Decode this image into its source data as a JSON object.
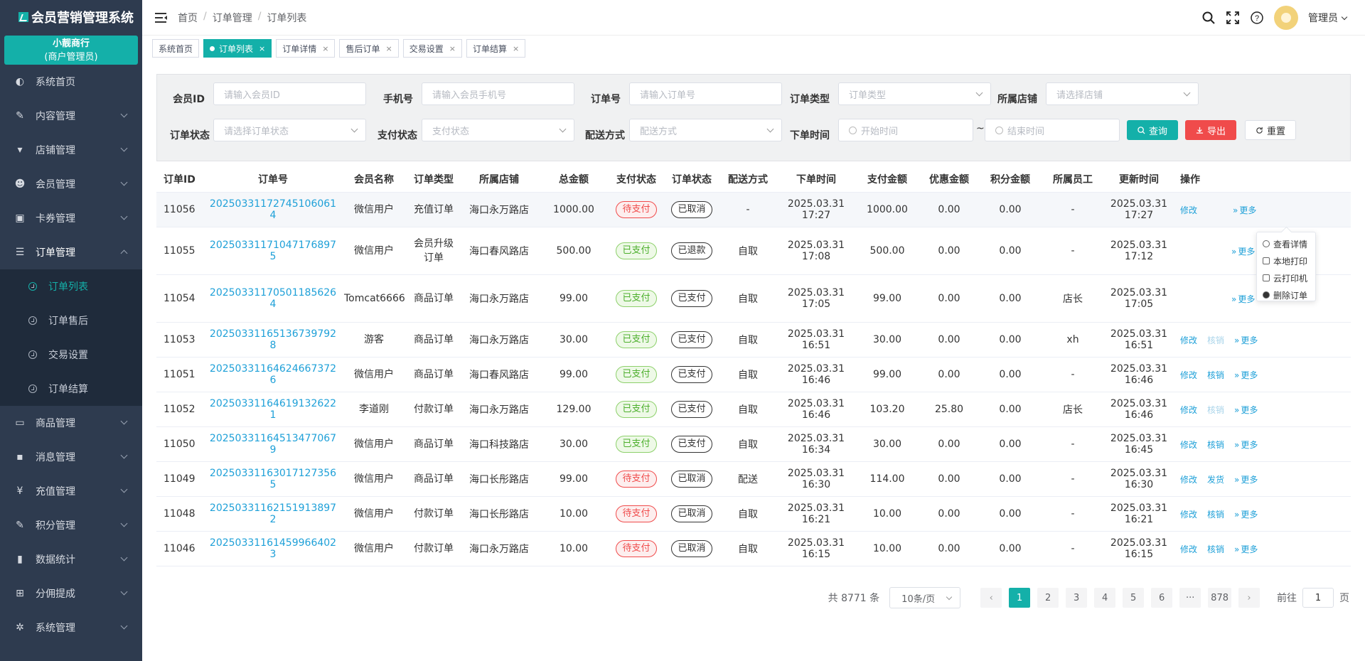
{
  "app": {
    "title": "会员营销管理系统"
  },
  "shop": {
    "name": "小靓商行",
    "role": "(商户管理员)"
  },
  "menu": [
    {
      "label": "系统首页",
      "icon": "dashboard-icon"
    },
    {
      "label": "内容管理",
      "icon": "edit-icon"
    },
    {
      "label": "店铺管理",
      "icon": "cart-icon"
    },
    {
      "label": "会员管理",
      "icon": "users-icon"
    },
    {
      "label": "卡券管理",
      "icon": "coupon-icon"
    },
    {
      "label": "订单管理",
      "icon": "list-icon"
    },
    {
      "label": "商品管理",
      "icon": "monitor-icon"
    },
    {
      "label": "消息管理",
      "icon": "message-icon"
    },
    {
      "label": "充值管理",
      "icon": "yen-icon"
    },
    {
      "label": "积分管理",
      "icon": "points-icon"
    },
    {
      "label": "数据统计",
      "icon": "bar-chart-icon"
    },
    {
      "label": "分佣提成",
      "icon": "sitemap-icon"
    },
    {
      "label": "系统管理",
      "icon": "gear-icon"
    }
  ],
  "submenu": [
    "订单列表",
    "订单售后",
    "交易设置",
    "订单结算"
  ],
  "breadcrumb": [
    "首页",
    "订单管理",
    "订单列表"
  ],
  "user": {
    "name": "管理员"
  },
  "tabs": [
    "系统首页",
    "订单列表",
    "订单详情",
    "售后订单",
    "交易设置",
    "订单结算"
  ],
  "filters": {
    "member_id": {
      "label": "会员ID",
      "placeholder": "请输入会员ID"
    },
    "phone": {
      "label": "手机号",
      "placeholder": "请输入会员手机号"
    },
    "order_no": {
      "label": "订单号",
      "placeholder": "请输入订单号"
    },
    "order_type": {
      "label": "订单类型",
      "placeholder": "订单类型"
    },
    "store": {
      "label": "所属店铺",
      "placeholder": "请选择店铺"
    },
    "order_status": {
      "label": "订单状态",
      "placeholder": "请选择订单状态"
    },
    "pay_status": {
      "label": "支付状态",
      "placeholder": "支付状态"
    },
    "delivery": {
      "label": "配送方式",
      "placeholder": "配送方式"
    },
    "order_time": {
      "label": "下单时间",
      "start": "开始时间",
      "sep": "~",
      "end": "结束时间"
    },
    "query_label": "查询",
    "export_label": "导出",
    "reset_label": "重置"
  },
  "table": {
    "headers": [
      "订单ID",
      "订单号",
      "会员名称",
      "订单类型",
      "所属店铺",
      "总金额",
      "支付状态",
      "订单状态",
      "配送方式",
      "下单时间",
      "支付金额",
      "优惠金额",
      "积分金额",
      "所属员工",
      "更新时间",
      "操作"
    ],
    "rows": [
      {
        "id": "11056",
        "no": "20250331172745106061 4",
        "member": "微信用户",
        "type": "充值订单",
        "store": "海口永万路店",
        "total": "1000.00",
        "pay": "待支付",
        "status": "已取消",
        "delivery": "-",
        "time": "2025.03.31 17:27",
        "paid": "1000.00",
        "discount": "0.00",
        "points": "0.00",
        "staff": "-",
        "updated": "2025.03.31 17:27",
        "ops": [
          "修改",
          "",
          "更多"
        ]
      },
      {
        "id": "11055",
        "no": "20250331171047176897 5",
        "member": "微信用户",
        "type": "会员升级订单",
        "store": "海口春风路店",
        "total": "500.00",
        "pay": "已支付",
        "status": "已退款",
        "delivery": "自取",
        "time": "2025.03.31 17:08",
        "paid": "500.00",
        "discount": "0.00",
        "points": "0.00",
        "staff": "-",
        "updated": "2025.03.31 17:12",
        "ops": [
          "",
          "",
          "更多"
        ]
      },
      {
        "id": "11054",
        "no": "20250331170501185626 4",
        "member": "Tomcat6666",
        "type": "商品订单",
        "store": "海口永万路店",
        "total": "99.00",
        "pay": "已支付",
        "status": "已支付",
        "delivery": "自取",
        "time": "2025.03.31 17:05",
        "paid": "99.00",
        "discount": "0.00",
        "points": "0.00",
        "staff": "店长",
        "updated": "2025.03.31 17:05",
        "ops": [
          "",
          "",
          "更多"
        ]
      },
      {
        "id": "11053",
        "no": "20250331165136739792 8",
        "member": "游客",
        "type": "商品订单",
        "store": "海口永万路店",
        "total": "30.00",
        "pay": "已支付",
        "status": "已支付",
        "delivery": "自取",
        "time": "2025.03.31 16:51",
        "paid": "30.00",
        "discount": "0.00",
        "points": "0.00",
        "staff": "xh",
        "updated": "2025.03.31 16:51",
        "ops": [
          "修改",
          "核销",
          "更多"
        ]
      },
      {
        "id": "11051",
        "no": "20250331164624667372 6",
        "member": "微信用户",
        "type": "商品订单",
        "store": "海口春风路店",
        "total": "99.00",
        "pay": "已支付",
        "status": "已支付",
        "delivery": "自取",
        "time": "2025.03.31 16:46",
        "paid": "99.00",
        "discount": "0.00",
        "points": "0.00",
        "staff": "-",
        "updated": "2025.03.31 16:46",
        "ops": [
          "修改",
          "核销",
          "更多"
        ]
      },
      {
        "id": "11052",
        "no": "20250331164619132622 1",
        "member": "李道刚",
        "type": "付款订单",
        "store": "海口永万路店",
        "total": "129.00",
        "pay": "已支付",
        "status": "已支付",
        "delivery": "自取",
        "time": "2025.03.31 16:46",
        "paid": "103.20",
        "discount": "25.80",
        "points": "0.00",
        "staff": "店长",
        "updated": "2025.03.31 16:46",
        "ops": [
          "修改",
          "核销",
          "更多"
        ]
      },
      {
        "id": "11050",
        "no": "20250331164513477067 9",
        "member": "微信用户",
        "type": "商品订单",
        "store": "海口科技路店",
        "total": "30.00",
        "pay": "已支付",
        "status": "已支付",
        "delivery": "自取",
        "time": "2025.03.31 16:34",
        "paid": "30.00",
        "discount": "0.00",
        "points": "0.00",
        "staff": "-",
        "updated": "2025.03.31 16:45",
        "ops": [
          "修改",
          "核销",
          "更多"
        ]
      },
      {
        "id": "11049",
        "no": "20250331163017127356 5",
        "member": "微信用户",
        "type": "商品订单",
        "store": "海口长彤路店",
        "total": "99.00",
        "pay": "待支付",
        "status": "已取消",
        "delivery": "配送",
        "time": "2025.03.31 16:30",
        "paid": "114.00",
        "discount": "0.00",
        "points": "0.00",
        "staff": "-",
        "updated": "2025.03.31 16:30",
        "ops": [
          "修改",
          "发货",
          "更多"
        ]
      },
      {
        "id": "11048",
        "no": "20250331162151913897 2",
        "member": "微信用户",
        "type": "付款订单",
        "store": "海口长彤路店",
        "total": "10.00",
        "pay": "待支付",
        "status": "已取消",
        "delivery": "自取",
        "time": "2025.03.31 16:21",
        "paid": "10.00",
        "discount": "0.00",
        "points": "0.00",
        "staff": "-",
        "updated": "2025.03.31 16:21",
        "ops": [
          "修改",
          "核销",
          "更多"
        ]
      },
      {
        "id": "11046",
        "no": "20250331161459966402 3",
        "member": "微信用户",
        "type": "付款订单",
        "store": "海口永万路店",
        "total": "10.00",
        "pay": "待支付",
        "status": "已取消",
        "delivery": "自取",
        "time": "2025.03.31 16:15",
        "paid": "10.00",
        "discount": "0.00",
        "points": "0.00",
        "staff": "-",
        "updated": "2025.03.31 16:15",
        "ops": [
          "修改",
          "核销",
          "更多"
        ]
      }
    ]
  },
  "dropdown": [
    "查看详情",
    "本地打印",
    "云打印机",
    "删除订单"
  ],
  "pagination": {
    "total": "共 8771 条",
    "page_size": "10条/页",
    "pages": [
      "1",
      "2",
      "3",
      "4",
      "5",
      "6",
      "···",
      "878"
    ],
    "prev": "‹",
    "next": "›",
    "goto_label": "前往",
    "goto_value": "1",
    "goto_suffix": "页"
  }
}
